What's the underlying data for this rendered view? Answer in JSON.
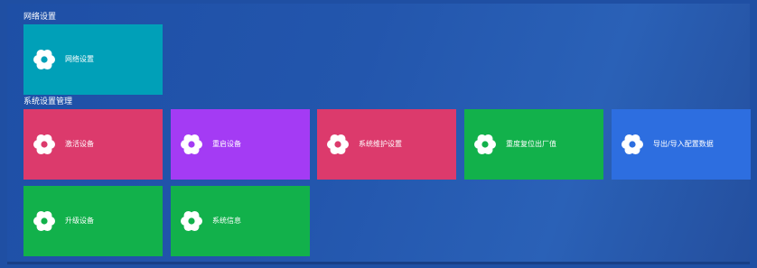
{
  "sections": [
    {
      "title": "网络设置"
    },
    {
      "title": "系统设置管理"
    }
  ],
  "tiles": [
    {
      "label": "网络设置",
      "color": "#00a0b8",
      "icon": "gear-icon"
    },
    {
      "label": "激活设备",
      "color": "#dc3a6c",
      "icon": "gear-icon"
    },
    {
      "label": "重启设备",
      "color": "#a43bf4",
      "icon": "gear-icon"
    },
    {
      "label": "系统维护设置",
      "color": "#dc3a6c",
      "icon": "gear-icon"
    },
    {
      "label": "重度复位出厂值",
      "color": "#12b14b",
      "icon": "gear-icon"
    },
    {
      "label": "导出/导入配置数据",
      "color": "#2d6ee0",
      "icon": "gear-icon"
    },
    {
      "label": "升级设备",
      "color": "#12b14b",
      "icon": "gear-icon"
    },
    {
      "label": "系统信息",
      "color": "#12b14b",
      "icon": "gear-icon"
    }
  ]
}
